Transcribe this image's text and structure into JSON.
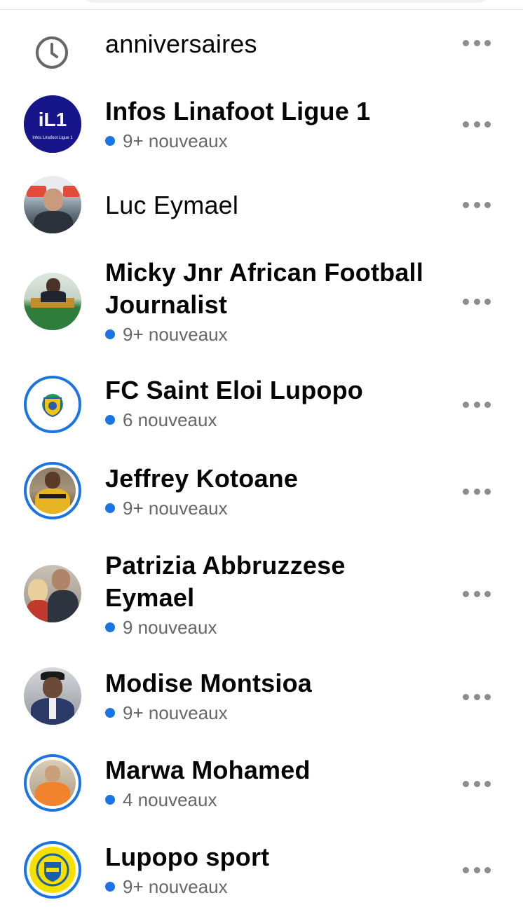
{
  "rows": [
    {
      "title": "anniversaires",
      "subtitle": null,
      "icon": "clock-icon"
    },
    {
      "title": "Infos Linafoot Ligue 1",
      "subtitle": "9+ nouveaux",
      "avatar_text": "iL1",
      "avatar_caption": "Infos Linafoot Ligue 1"
    },
    {
      "title": "Luc Eymael",
      "subtitle": null
    },
    {
      "title_line1": "Micky Jnr African Football",
      "title_line2": "Journalist",
      "subtitle": "9+ nouveaux"
    },
    {
      "title": "FC Saint Eloi Lupopo",
      "subtitle": "6 nouveaux"
    },
    {
      "title": "Jeffrey Kotoane",
      "subtitle": "9+ nouveaux"
    },
    {
      "title_line1": "Patrizia Abbruzzese",
      "title_line2": "Eymael",
      "subtitle": "9 nouveaux"
    },
    {
      "title": "Modise Montsioa",
      "subtitle": "9+ nouveaux"
    },
    {
      "title": "Marwa Mohamed",
      "subtitle": "4 nouveaux"
    },
    {
      "title": "Lupopo sport",
      "subtitle": "9+ nouveaux"
    }
  ],
  "colors": {
    "accent": "#1b74e4",
    "secondary_text": "#65676b",
    "dots": "#8a8d91"
  }
}
